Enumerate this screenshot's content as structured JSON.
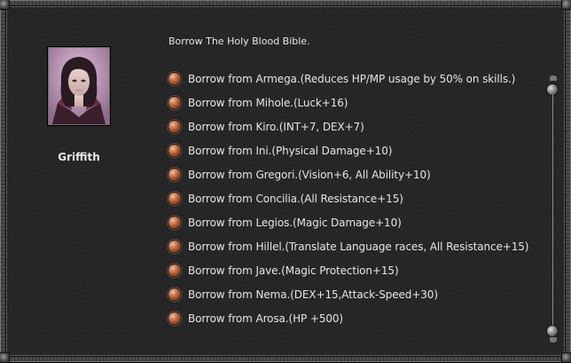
{
  "npc": {
    "name": "Griffith",
    "portrait_icon": "woman-portrait-icon"
  },
  "dialog": {
    "title": "Borrow The Holy Blood Bible.",
    "options": [
      {
        "label": "Borrow from Armega.(Reduces HP/MP usage by 50% on skills.)"
      },
      {
        "label": "Borrow from Mihole.(Luck+16)"
      },
      {
        "label": "Borrow from Kiro.(INT+7, DEX+7)"
      },
      {
        "label": "Borrow from Ini.(Physical Damage+10)"
      },
      {
        "label": "Borrow from Gregori.(Vision+6, All Ability+10)"
      },
      {
        "label": "Borrow from Concilia.(All Resistance+15)"
      },
      {
        "label": "Borrow from Legios.(Magic Damage+10)"
      },
      {
        "label": "Borrow from Hillel.(Translate Language races, All Resistance+15)"
      },
      {
        "label": "Borrow from Jave.(Magic Protection+15)"
      },
      {
        "label": "Borrow from Nema.(DEX+15,Attack-Speed+30)"
      },
      {
        "label": "Borrow from Arosa.(HP +500)"
      }
    ]
  },
  "colors": {
    "panel_bg": "#262626",
    "text": "#e6e6e6",
    "bullet": "#c87a4c",
    "frame": "#4a4a4a"
  }
}
